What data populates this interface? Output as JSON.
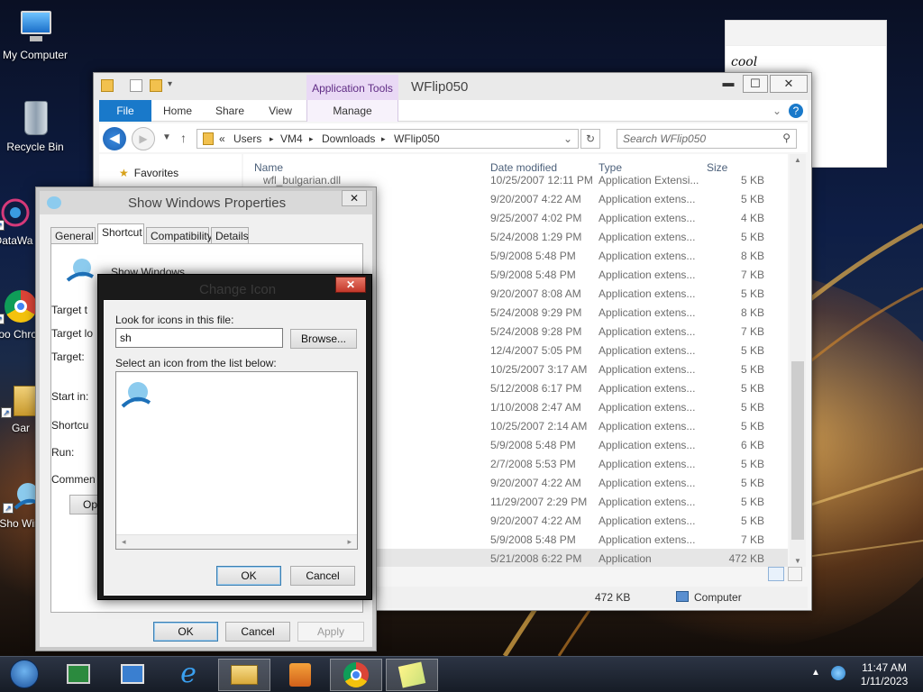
{
  "desktop": {
    "icons": [
      {
        "label": "My Computer",
        "icon": "my-computer-icon"
      },
      {
        "label": "Recycle Bin",
        "icon": "recycle-bin-icon"
      },
      {
        "label": "DataWa",
        "icon": "datawa-icon"
      },
      {
        "label": "Goo Chro",
        "icon": "chrome-icon"
      },
      {
        "label": "Gar",
        "icon": "folder-shortcut-icon"
      },
      {
        "label": "Sho Winc",
        "icon": "show-windows-icon"
      }
    ]
  },
  "note": {
    "text": "cool"
  },
  "explorer": {
    "contextual_tab": "Application Tools",
    "title": "WFlip050",
    "tabs": [
      "File",
      "Home",
      "Share",
      "View",
      "Manage"
    ],
    "address": {
      "prefix": "«",
      "parts": [
        "Users",
        "VM4",
        "Downloads",
        "WFlip050"
      ],
      "sep": "▸"
    },
    "search_placeholder": "Search WFlip050",
    "nav": {
      "favorites": "Favorites"
    },
    "columns": {
      "name": "Name",
      "date": "Date modified",
      "type": "Type",
      "size": "Size"
    },
    "partial_row": {
      "name": "wfl_bulgarian.dll",
      "date": "10/25/2007 12:11 PM",
      "type": "Application Extensi...",
      "size": "5 KB"
    },
    "rows": [
      {
        "date": "9/20/2007 4:22 AM",
        "type": "Application extens...",
        "size": "5 KB"
      },
      {
        "date": "9/25/2007 4:02 PM",
        "type": "Application extens...",
        "size": "4 KB"
      },
      {
        "date": "5/24/2008 1:29 PM",
        "type": "Application extens...",
        "size": "5 KB"
      },
      {
        "date": "5/9/2008 5:48 PM",
        "type": "Application extens...",
        "size": "8 KB"
      },
      {
        "date": "5/9/2008 5:48 PM",
        "type": "Application extens...",
        "size": "7 KB"
      },
      {
        "date": "9/20/2007 8:08 AM",
        "type": "Application extens...",
        "size": "5 KB"
      },
      {
        "date": "5/24/2008 9:29 PM",
        "type": "Application extens...",
        "size": "8 KB"
      },
      {
        "date": "5/24/2008 9:28 PM",
        "type": "Application extens...",
        "size": "7 KB"
      },
      {
        "date": "12/4/2007 5:05 PM",
        "type": "Application extens...",
        "size": "5 KB"
      },
      {
        "date": "10/25/2007 3:17 AM",
        "type": "Application extens...",
        "size": "5 KB"
      },
      {
        "date": "5/12/2008 6:17 PM",
        "type": "Application extens...",
        "size": "5 KB"
      },
      {
        "date": "1/10/2008 2:47 AM",
        "type": "Application extens...",
        "size": "5 KB"
      },
      {
        "date": "10/25/2007 2:14 AM",
        "type": "Application extens...",
        "size": "5 KB"
      },
      {
        "date": "5/9/2008 5:48 PM",
        "type": "Application extens...",
        "size": "6 KB"
      },
      {
        "date": "2/7/2008 5:53 PM",
        "type": "Application extens...",
        "size": "5 KB"
      },
      {
        "date": "9/20/2007 4:22 AM",
        "type": "Application extens...",
        "size": "5 KB"
      },
      {
        "date": "11/29/2007 2:29 PM",
        "type": "Application extens...",
        "size": "5 KB"
      },
      {
        "date": "9/20/2007 4:22 AM",
        "type": "Application extens...",
        "size": "5 KB"
      },
      {
        "date": "5/9/2008 5:48 PM",
        "type": "Application extens...",
        "size": "7 KB"
      },
      {
        "date": "5/21/2008 6:22 PM",
        "type": "Application",
        "size": "472 KB"
      }
    ],
    "status": {
      "size": "472 KB",
      "location": "Computer"
    }
  },
  "props": {
    "title": "Show Windows Properties",
    "tabs": [
      "General",
      "Shortcut",
      "Compatibility",
      "Details"
    ],
    "name": "Show Windows",
    "labels": [
      "Target t",
      "Target lo",
      "Target:",
      "Start in:",
      "Shortcu",
      "Run:",
      "Commen"
    ],
    "open_button": "Ope",
    "buttons": {
      "ok": "OK",
      "cancel": "Cancel",
      "apply": "Apply"
    }
  },
  "change_icon": {
    "title": "Change Icon",
    "look_label": "Look for icons in this file:",
    "file_value": "sh",
    "browse": "Browse...",
    "select_label": "Select an icon from the list below:",
    "ok": "OK",
    "cancel": "Cancel"
  },
  "taskbar": {
    "items": [
      "start-orb",
      "network-monitor-icon",
      "remote-desktop-icon",
      "internet-explorer-icon",
      "file-explorer-icon",
      "media-player-icon",
      "chrome-icon",
      "sticky-notes-icon"
    ],
    "time": "11:47 AM",
    "date": "1/11/2023"
  }
}
